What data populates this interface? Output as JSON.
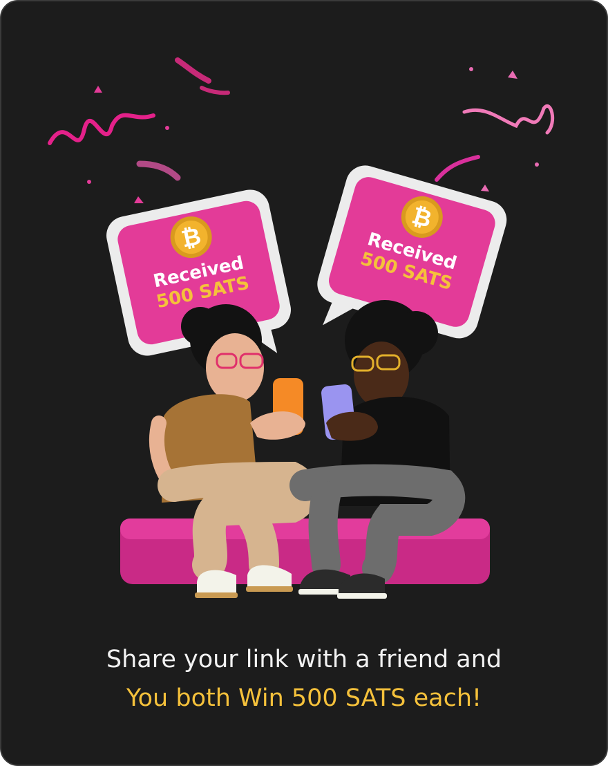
{
  "bubbles": {
    "left": {
      "title": "Received",
      "amount": "500 SATS"
    },
    "right": {
      "title": "Received",
      "amount": "500 SATS"
    }
  },
  "caption": {
    "line1": "Share your link with a friend and",
    "line2": "You both Win 500 SATS each!"
  },
  "colors": {
    "background": "#1c1c1c",
    "accent_pink": "#e33b98",
    "accent_gold": "#f5c13b",
    "text_light": "#f2f2f2"
  },
  "icons": [
    "bitcoin-icon",
    "confetti"
  ]
}
